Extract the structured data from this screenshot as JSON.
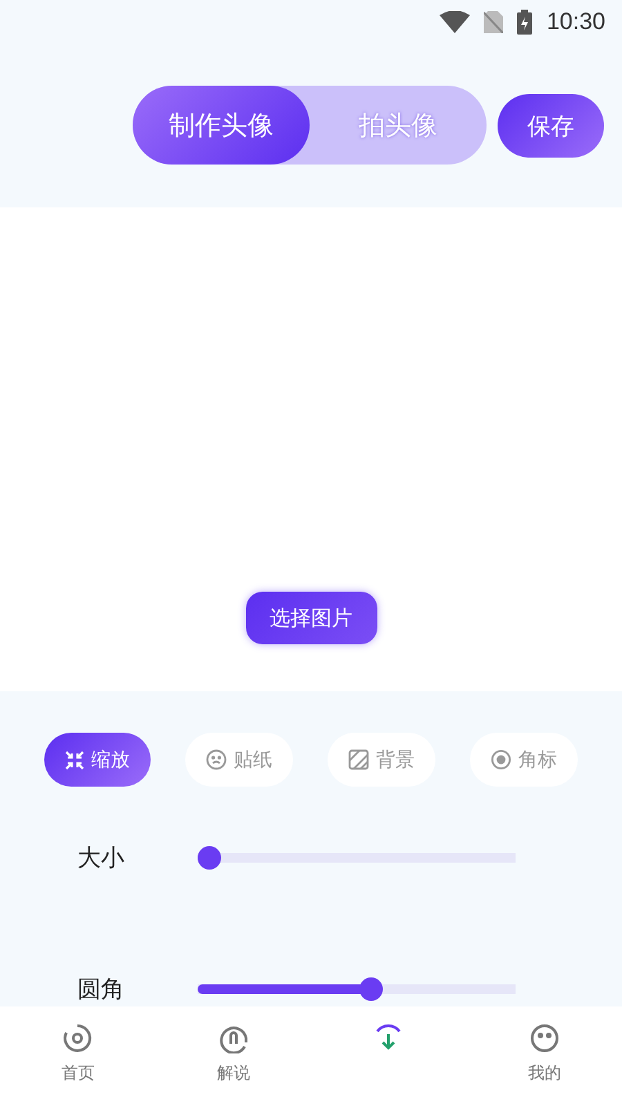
{
  "status_bar": {
    "time": "10:30"
  },
  "mode_tabs": [
    {
      "label": "制作头像",
      "selected": true
    },
    {
      "label": "拍头像",
      "selected": false
    }
  ],
  "save_button": "保存",
  "canvas": {
    "select_button": "选择图片"
  },
  "tool_tabs": [
    {
      "label": "缩放",
      "kind": "shrink",
      "selected": true
    },
    {
      "label": "贴纸",
      "kind": "sticker",
      "selected": false
    },
    {
      "label": "背景",
      "kind": "background",
      "selected": false
    },
    {
      "label": "角标",
      "kind": "corner",
      "selected": false
    }
  ],
  "sliders": [
    {
      "label": "大小",
      "level": 0
    },
    {
      "label": "圆角",
      "level": 0.55
    }
  ],
  "bottom_nav": [
    {
      "label": "首页",
      "selected": false
    },
    {
      "label": "解说",
      "selected": false
    },
    {
      "selected": true
    },
    {
      "label": "我的",
      "selected": false
    }
  ]
}
